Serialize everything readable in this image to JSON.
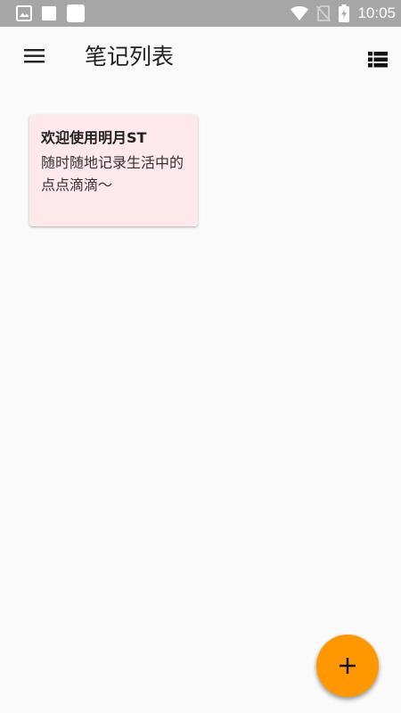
{
  "status_bar": {
    "time": "10:05",
    "left_icons": [
      "image-icon",
      "square-icon",
      "square-icon"
    ],
    "right_icons": [
      "wifi-icon",
      "no-sim-icon",
      "battery-charging-icon"
    ]
  },
  "app_bar": {
    "title": "笔记列表",
    "menu_icon": "menu-icon",
    "view_toggle_icon": "view-list-icon"
  },
  "notes": [
    {
      "title": "欢迎使用明月ST",
      "body": "随时随地记录生活中的点点滴滴～",
      "background": "#fde8eb"
    }
  ],
  "fab": {
    "icon": "add-icon",
    "color": "#ff9800"
  },
  "colors": {
    "status_bar": "#a6a6a6",
    "background": "#fafafa",
    "accent": "#ff9800",
    "note_pink": "#fde8eb"
  }
}
